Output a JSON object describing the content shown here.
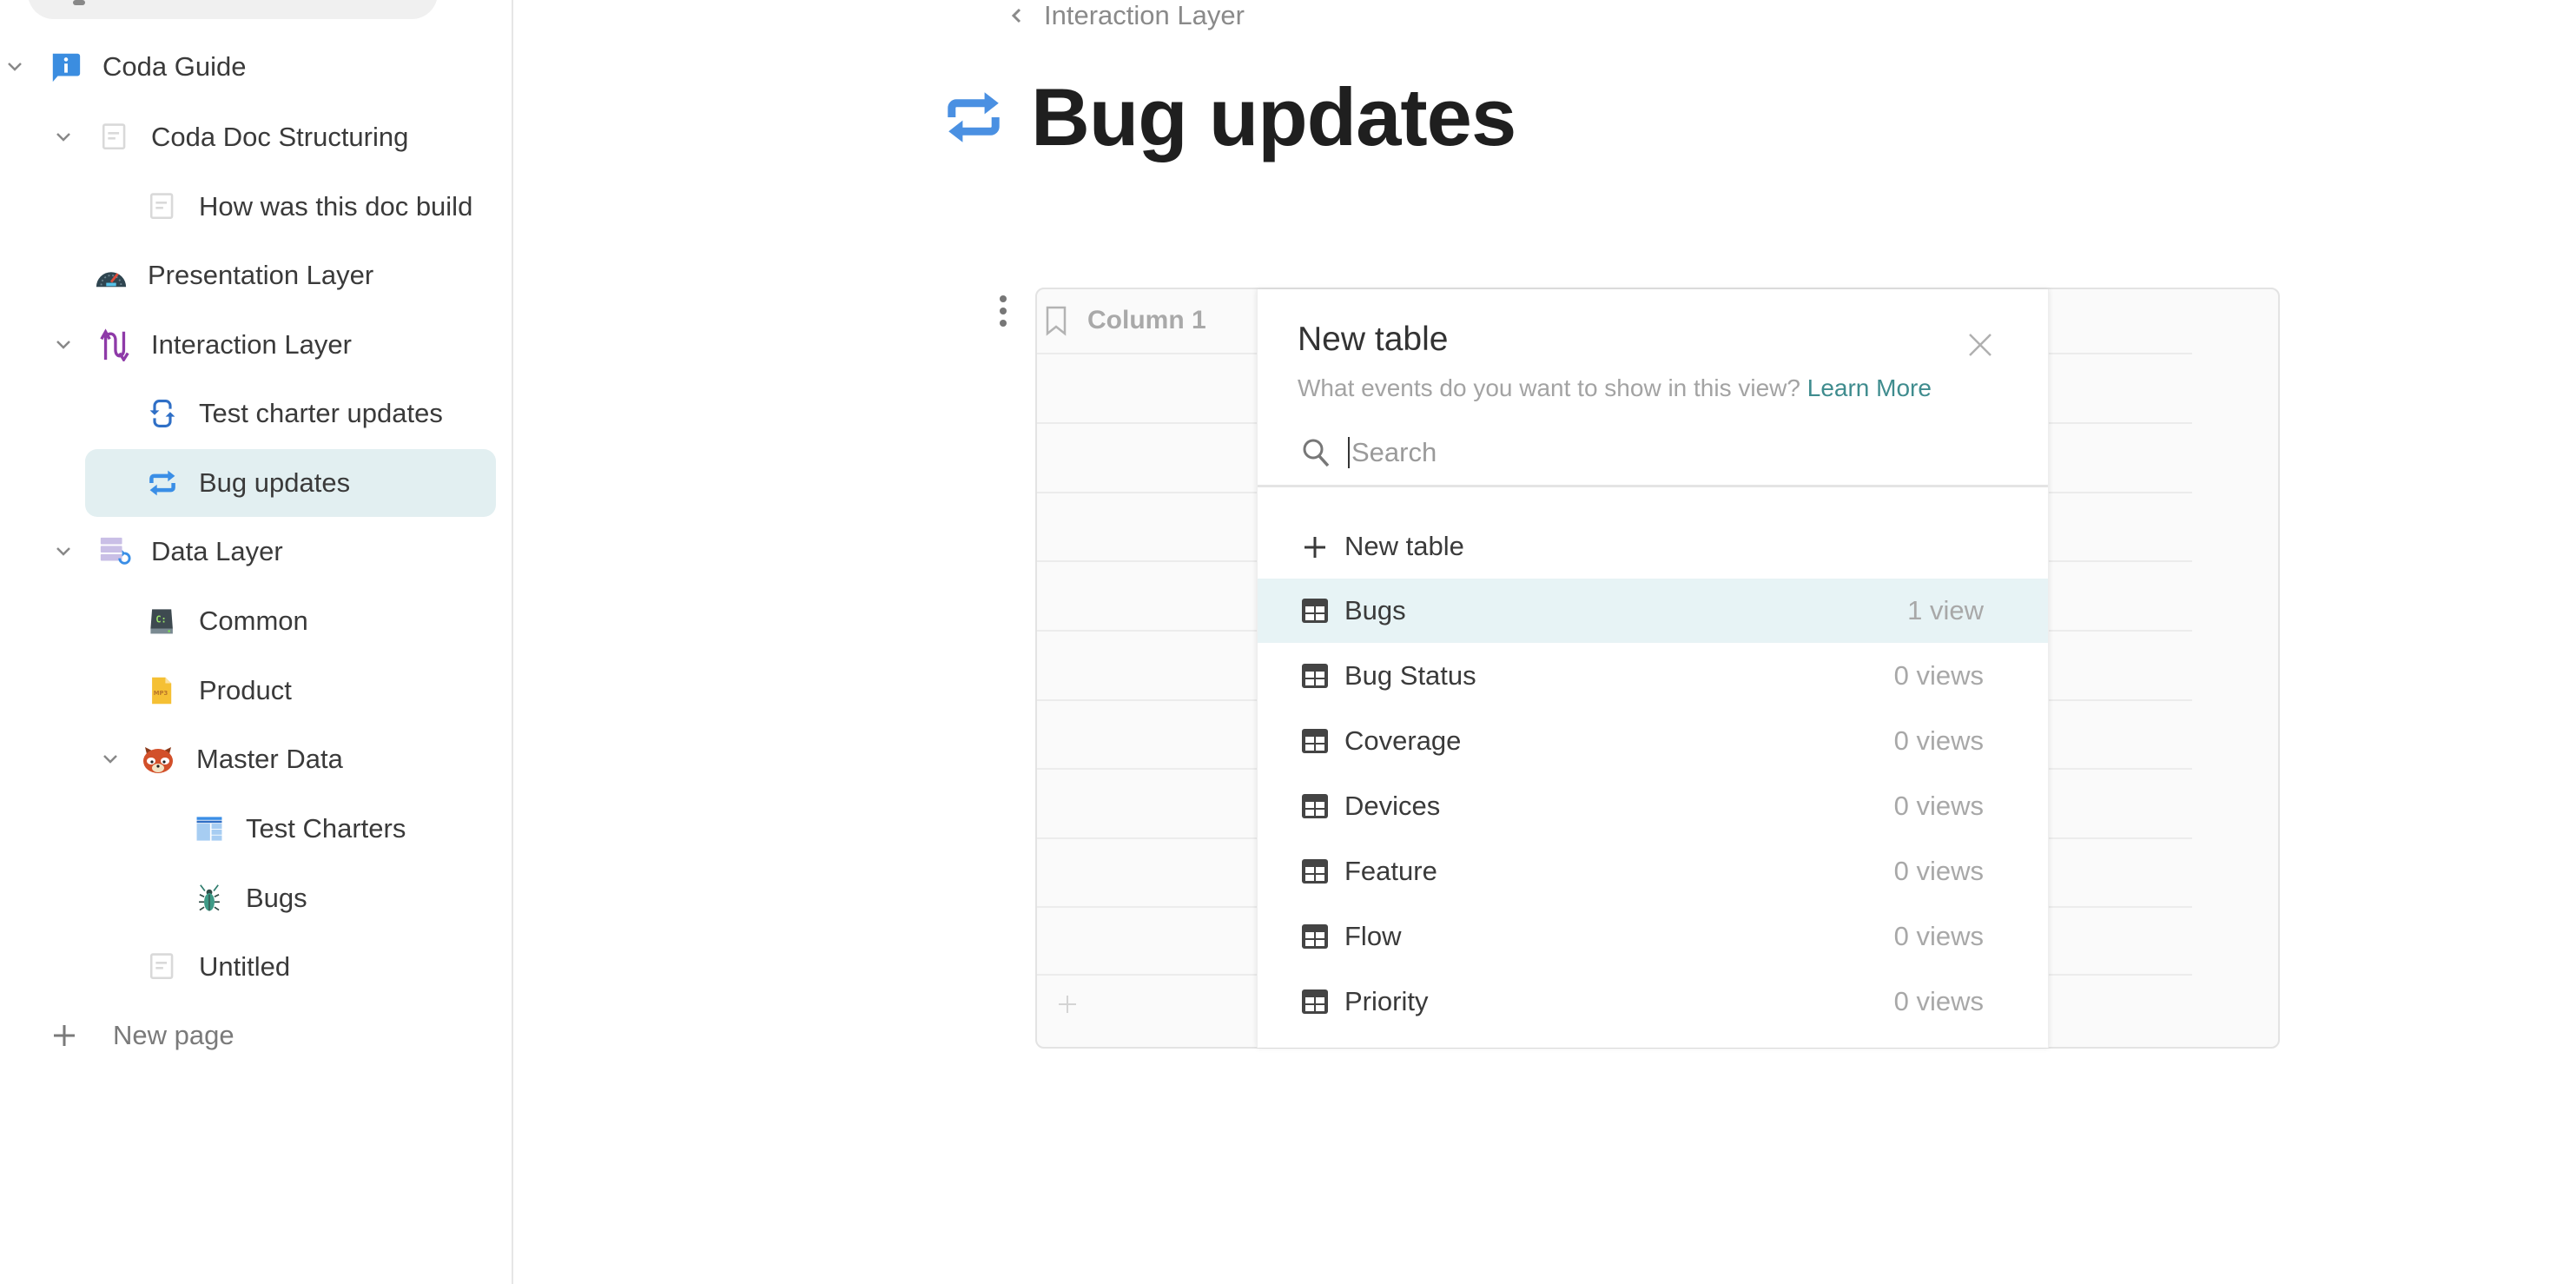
{
  "sidebar": {
    "items": [
      {
        "label": "Coda Guide",
        "icon": "info-speech-bubble-icon",
        "expanded": true
      },
      {
        "label": "Coda Doc Structuring",
        "icon": "page-icon",
        "expanded": true
      },
      {
        "label": "How was this doc build",
        "icon": "page-icon"
      },
      {
        "label": "Presentation Layer",
        "icon": "speedometer-icon"
      },
      {
        "label": "Interaction Layer",
        "icon": "up-down-arrows-icon",
        "expanded": true
      },
      {
        "label": "Test charter updates",
        "icon": "refresh-arrows-icon"
      },
      {
        "label": "Bug updates",
        "icon": "repeat-arrows-icon",
        "active": true
      },
      {
        "label": "Data Layer",
        "icon": "database-refresh-icon",
        "expanded": true
      },
      {
        "label": "Common",
        "icon": "drive-c-icon"
      },
      {
        "label": "Product",
        "icon": "mp3-file-icon"
      },
      {
        "label": "Master Data",
        "icon": "red-panda-icon",
        "expanded": true
      },
      {
        "label": "Test Charters",
        "icon": "table-layout-icon"
      },
      {
        "label": "Bugs",
        "icon": "beetle-icon"
      },
      {
        "label": "Untitled",
        "icon": "page-icon"
      }
    ],
    "new_page_label": "New page"
  },
  "breadcrumb": {
    "parent": "Interaction Layer"
  },
  "page": {
    "title": "Bug updates",
    "icon": "repeat-arrows-icon"
  },
  "table": {
    "column_header": "Column 1"
  },
  "popup": {
    "title": "New table",
    "subtitle": "What events do you want to show in this view?",
    "learn_more": "Learn More",
    "search_placeholder": "Search",
    "search_value": "",
    "new_table_label": "New table",
    "options": [
      {
        "name": "Bugs",
        "count": "1 view",
        "highlighted": true
      },
      {
        "name": "Bug Status",
        "count": "0 views"
      },
      {
        "name": "Coverage",
        "count": "0 views"
      },
      {
        "name": "Devices",
        "count": "0 views"
      },
      {
        "name": "Feature",
        "count": "0 views"
      },
      {
        "name": "Flow",
        "count": "0 views"
      },
      {
        "name": "Priority",
        "count": "0 views"
      }
    ]
  },
  "colors": {
    "accent_link": "#3f8c8e",
    "highlight_row": "#e7f3f5",
    "active_sidebar": "#e2eff1",
    "title_icon_blue": "#4a90e2"
  }
}
